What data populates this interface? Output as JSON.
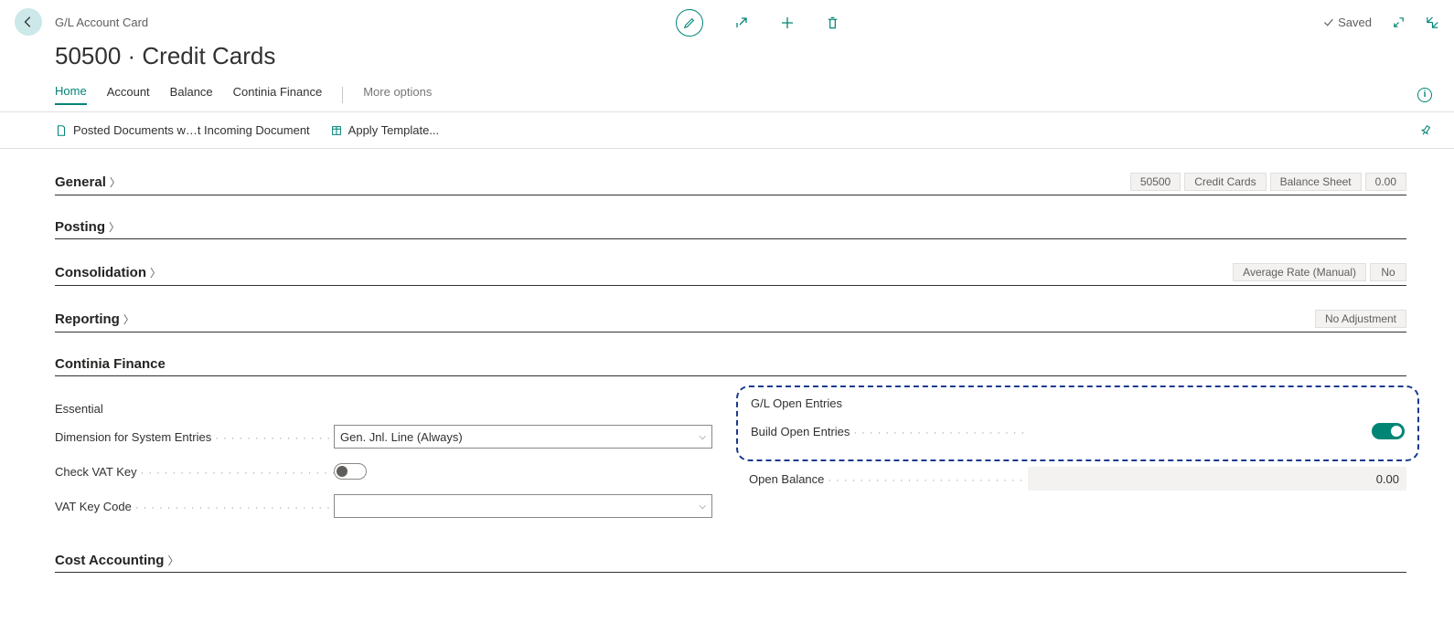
{
  "header": {
    "breadcrumb": "G/L Account Card",
    "title": "50500 · Credit Cards",
    "saved_label": "Saved"
  },
  "tabs": {
    "home": "Home",
    "account": "Account",
    "balance": "Balance",
    "continia": "Continia Finance",
    "more": "More options"
  },
  "actions": {
    "posted_docs": "Posted Documents w…t Incoming Document",
    "apply_template": "Apply Template..."
  },
  "fasttabs": {
    "general": {
      "title": "General",
      "summary": {
        "no": "50500",
        "name": "Credit Cards",
        "cat": "Balance Sheet",
        "bal": "0.00"
      }
    },
    "posting": {
      "title": "Posting"
    },
    "consolidation": {
      "title": "Consolidation",
      "summary": {
        "method": "Average Rate (Manual)",
        "flag": "No"
      }
    },
    "reporting": {
      "title": "Reporting",
      "summary": {
        "adj": "No Adjustment"
      }
    },
    "continia": {
      "title": "Continia Finance"
    },
    "costacc": {
      "title": "Cost Accounting"
    }
  },
  "continia": {
    "essential_label": "Essential",
    "dim_label": "Dimension for System Entries",
    "dim_value": "Gen. Jnl. Line (Always)",
    "check_vat_label": "Check VAT Key",
    "vat_key_code_label": "VAT Key Code",
    "vat_key_code_value": "",
    "gl_open_label": "G/L Open Entries",
    "build_open_label": "Build Open Entries",
    "open_balance_label": "Open Balance",
    "open_balance_value": "0.00"
  }
}
